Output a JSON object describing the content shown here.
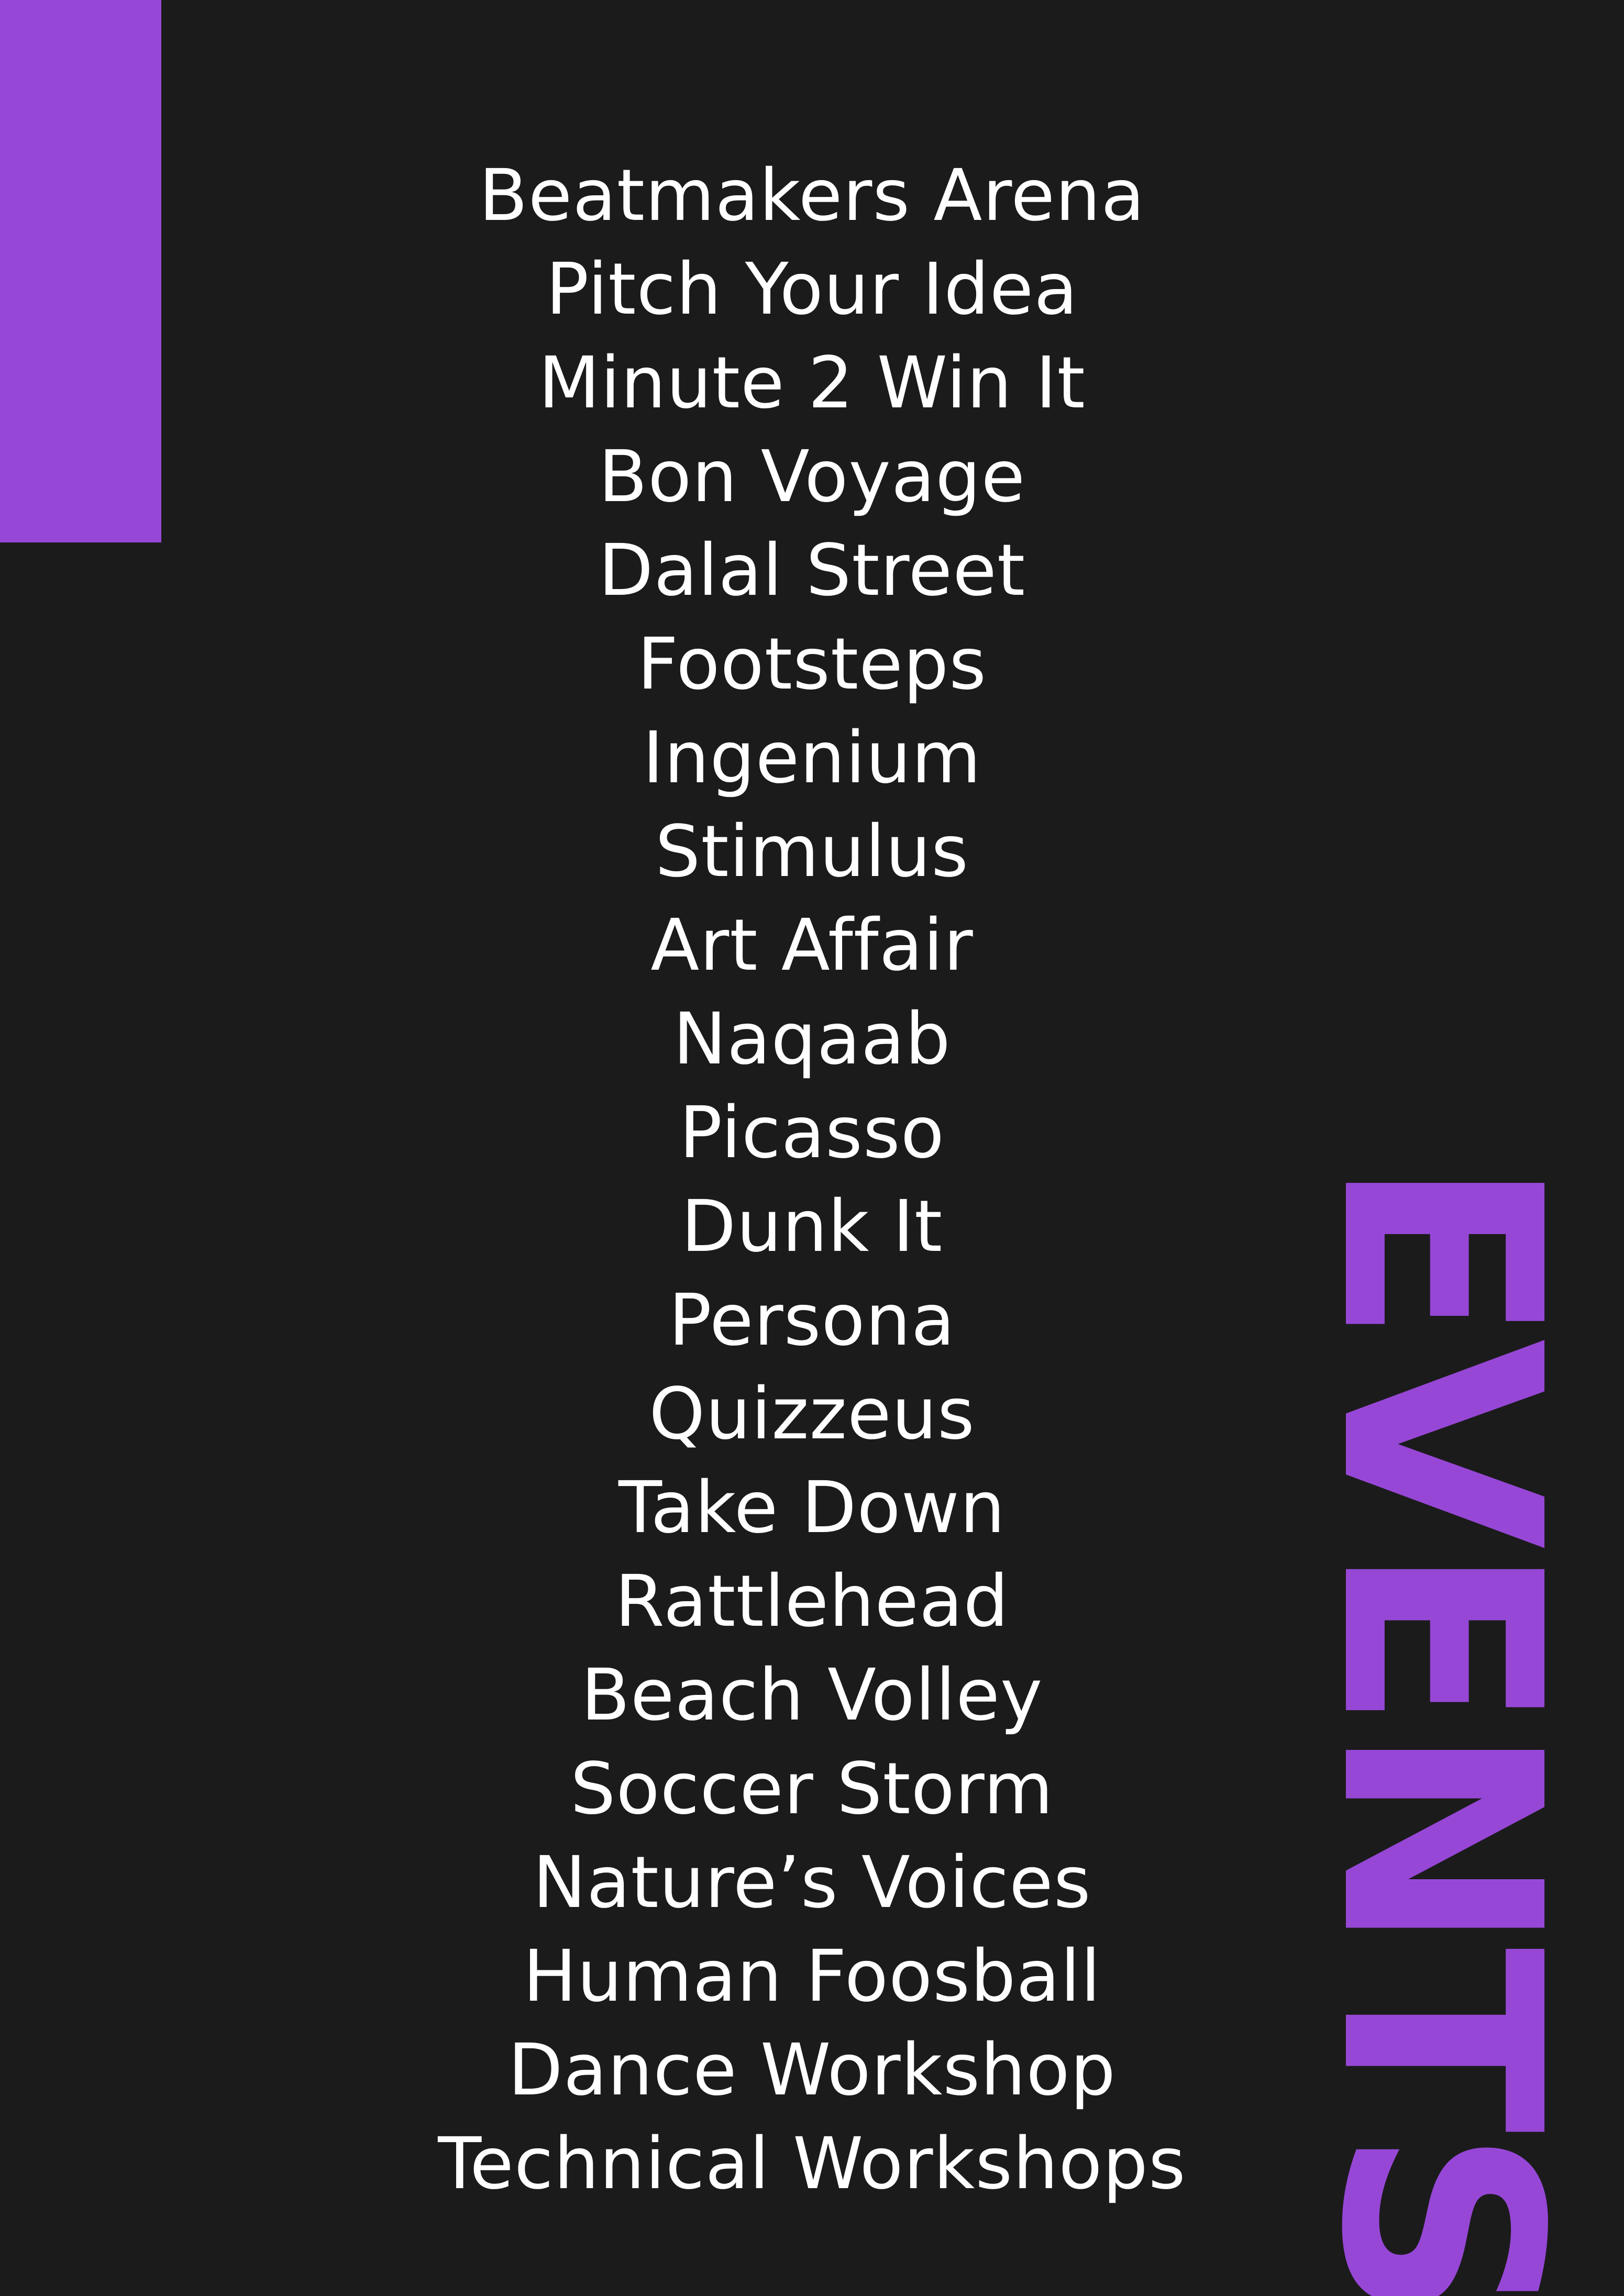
{
  "colors": {
    "background": "#1b1b1c",
    "accent": "#9747d6",
    "text": "#ffffff"
  },
  "title": "EVENTS",
  "events": [
    "Beatmakers Arena",
    "Pitch Your Idea",
    "Minute 2 Win It",
    "Bon Voyage",
    "Dalal Street",
    "Footsteps",
    "Ingenium",
    "Stimulus",
    "Art Affair",
    "Naqaab",
    "Picasso",
    "Dunk It",
    "Persona",
    "Quizzeus",
    "Take Down",
    "Rattlehead",
    "Beach Volley",
    "Soccer Storm",
    "Nature’s Voices",
    "Human Foosball",
    "Dance Workshop",
    "Technical Workshops"
  ]
}
